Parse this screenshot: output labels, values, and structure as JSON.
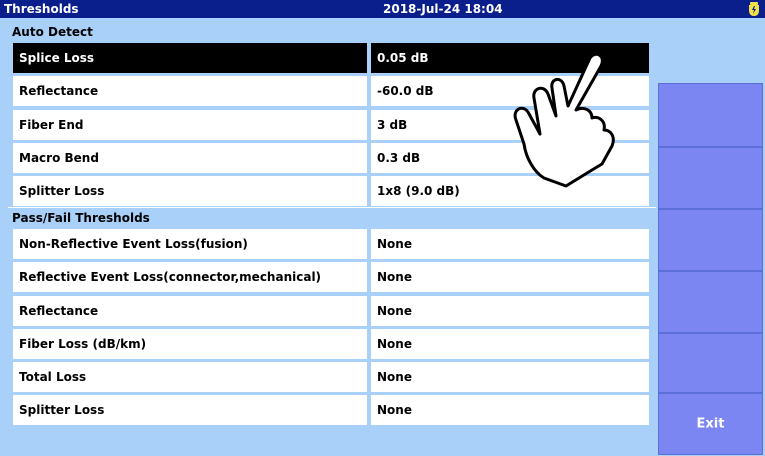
{
  "header": {
    "title": "Thresholds",
    "datetime": "2018-Jul-24 18:04",
    "battery_icon": "battery-charging-icon"
  },
  "auto_detect": {
    "heading": "Auto Detect",
    "rows": [
      {
        "label": "Splice Loss",
        "value": "0.05 dB",
        "selected": true
      },
      {
        "label": "Reflectance",
        "value": "-60.0 dB",
        "selected": false
      },
      {
        "label": "Fiber End",
        "value": "3 dB",
        "selected": false
      },
      {
        "label": "Macro Bend",
        "value": "0.3 dB",
        "selected": false
      },
      {
        "label": "Splitter Loss",
        "value": "1x8 (9.0 dB)",
        "selected": false
      }
    ]
  },
  "pass_fail": {
    "heading": "Pass/Fail Thresholds",
    "rows": [
      {
        "label": "Non-Reflective Event Loss(fusion)",
        "value": "None"
      },
      {
        "label": "Reflective Event Loss(connector,mechanical)",
        "value": "None"
      },
      {
        "label": "Reflectance",
        "value": "None"
      },
      {
        "label": "Fiber Loss (dB/km)",
        "value": "None"
      },
      {
        "label": "Total Loss",
        "value": "None"
      },
      {
        "label": "Splitter Loss",
        "value": "None"
      }
    ]
  },
  "softkeys": {
    "exit_label": "Exit"
  },
  "colors": {
    "title_bar": "#0a1e8c",
    "background": "#a8d0f8",
    "softkey": "#7c86f2",
    "selected_row": "#000000"
  }
}
